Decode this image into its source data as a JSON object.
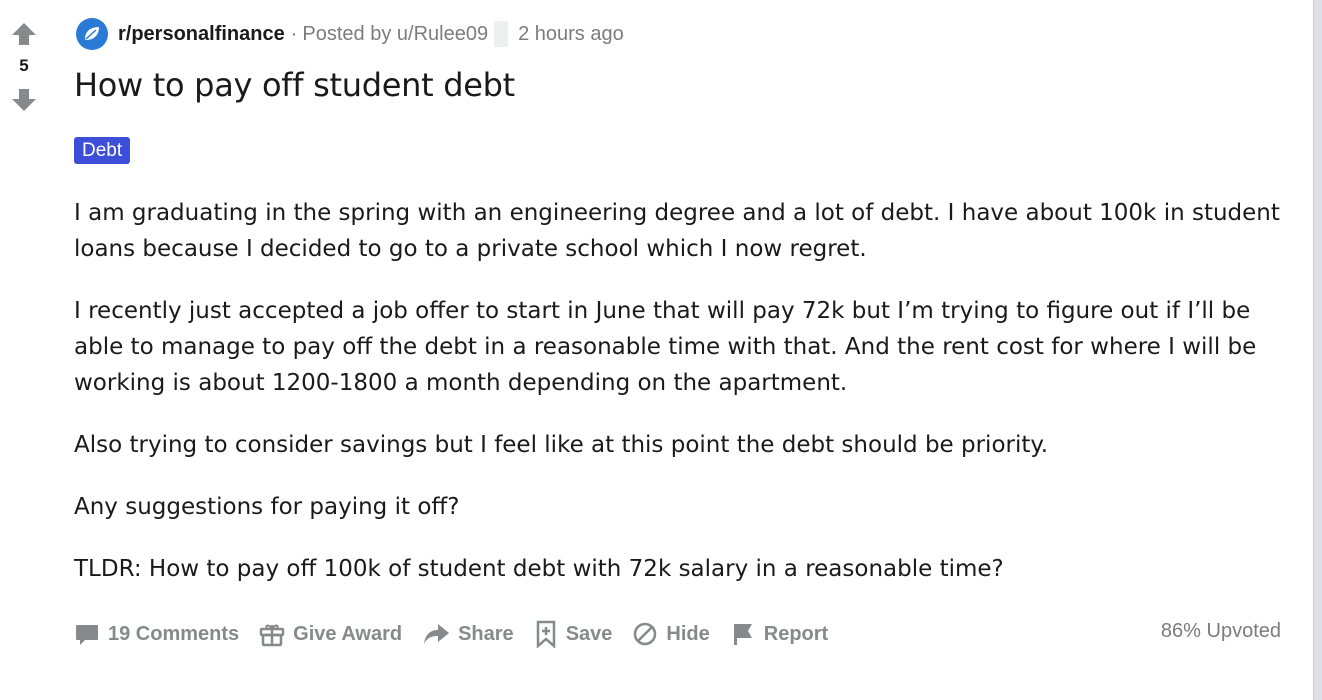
{
  "vote": {
    "score": "5"
  },
  "header": {
    "subreddit": "r/personalfinance",
    "separator": "·",
    "posted_by": "Posted by u/Rulee09",
    "time": "2 hours ago"
  },
  "post": {
    "title": "How to pay off student debt",
    "flair": "Debt",
    "flair_color": "#3d4ed8",
    "paragraphs": [
      "I am graduating in the spring with an engineering degree and a lot of debt. I have about 100k in student loans because I decided to go to a private school which I now regret.",
      "I recently just accepted a job offer to start in June that will pay 72k but I’m trying to figure out if I’ll be able to manage to pay off the debt in a reasonable time with that. And the rent cost for where I will be working is about 1200-1800 a month depending on the apartment.",
      "Also trying to consider savings but I feel like at this point the debt should be priority.",
      "Any suggestions for paying it off?",
      "TLDR: How to pay off 100k of student debt with 72k salary in a reasonable time?"
    ]
  },
  "actions": {
    "comments": "19 Comments",
    "give_award": "Give Award",
    "share": "Share",
    "save": "Save",
    "hide": "Hide",
    "report": "Report",
    "upvoted": "86% Upvoted"
  },
  "icons": {
    "upvote": "upvote-arrow-icon",
    "downvote": "downvote-arrow-icon",
    "subreddit": "subreddit-leaf-icon",
    "comments": "comment-bubble-icon",
    "award": "gift-icon",
    "share": "share-arrow-icon",
    "save": "bookmark-plus-icon",
    "hide": "hide-circle-slash-icon",
    "report": "flag-icon"
  },
  "colors": {
    "subreddit_avatar": "#2a7bd6",
    "meta_text": "#7c7c7c",
    "action_text": "#878a8c"
  }
}
